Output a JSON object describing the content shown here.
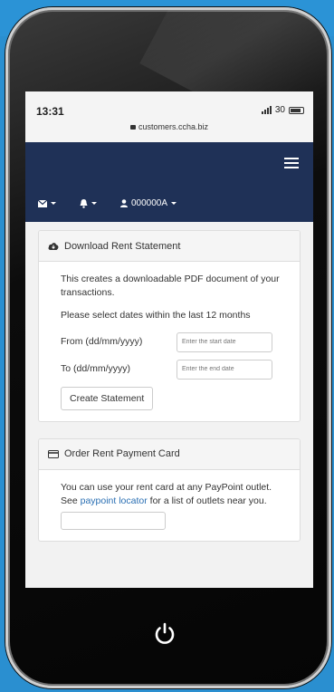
{
  "status_bar": {
    "time": "13:31",
    "signal_label": "30",
    "url": "customers.ccha.biz"
  },
  "navbar": {
    "user_label": "000000A",
    "mail_icon": "envelope-icon",
    "notifications_icon": "bell-icon",
    "user_icon": "user-icon",
    "menu_icon": "hamburger-icon",
    "background": "#1f3157"
  },
  "rent_statement": {
    "title": "Download Rent Statement",
    "icon": "cloud-download-icon",
    "description": "This creates a downloadable PDF document of your transactions.",
    "instruction": "Please select dates within the last 12 months",
    "from_label": "From (dd/mm/yyyy)",
    "from_placeholder": "Enter the start date",
    "to_label": "To (dd/mm/yyyy)",
    "to_placeholder": "Enter the end date",
    "button_label": "Create Statement"
  },
  "payment_card": {
    "title": "Order Rent Payment Card",
    "icon": "credit-card-icon",
    "text_before": "You can use your rent card at any PayPoint outlet. See ",
    "link_text": "paypoint locator",
    "text_after": " for a list of outlets near you."
  },
  "device": {
    "home_icon": "power-icon",
    "background": "#2a8fd0"
  }
}
